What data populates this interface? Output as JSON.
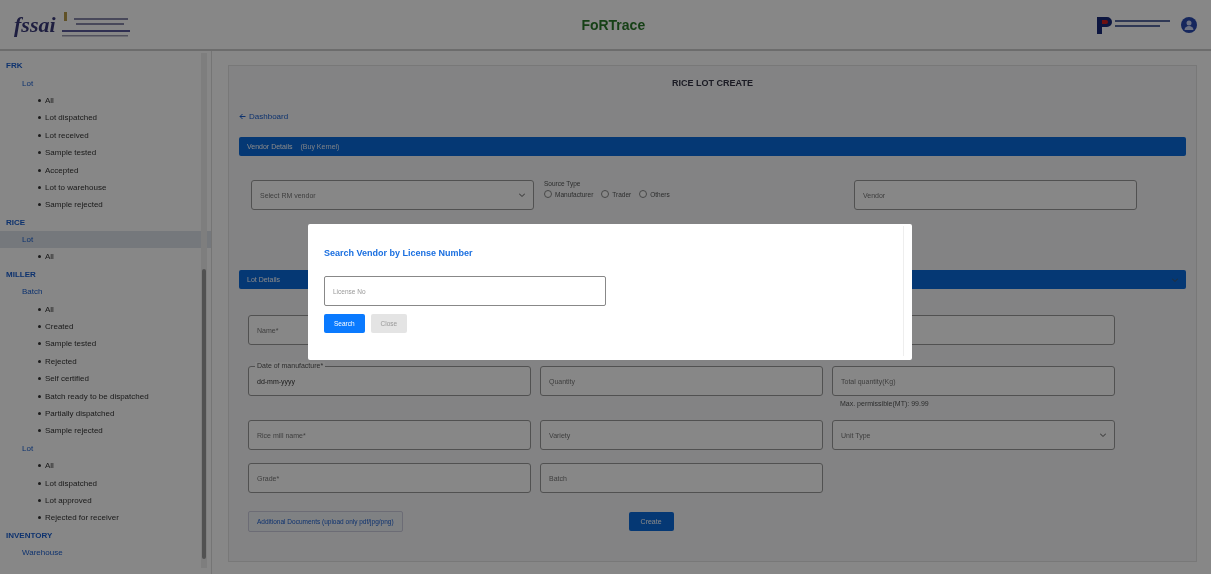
{
  "header": {
    "logo_text": "fssai",
    "title": "FoRTrace"
  },
  "sidebar": {
    "items": [
      {
        "label": "FRK",
        "selected": false,
        "children": [
          {
            "label": "Lot",
            "selected": false,
            "children": [
              {
                "label": "All",
                "selected": false
              },
              {
                "label": "Lot dispatched",
                "selected": false
              },
              {
                "label": "Lot received",
                "selected": false
              },
              {
                "label": "Sample tested",
                "selected": false
              },
              {
                "label": "Accepted",
                "selected": false
              },
              {
                "label": "Lot to warehouse",
                "selected": false
              },
              {
                "label": "Sample rejected",
                "selected": false
              }
            ]
          }
        ]
      },
      {
        "label": "RICE",
        "selected": false,
        "children": [
          {
            "label": "Lot",
            "selected": true,
            "children": [
              {
                "label": "All",
                "selected": false
              }
            ]
          }
        ]
      },
      {
        "label": "MILLER",
        "selected": false,
        "children": [
          {
            "label": "Batch",
            "selected": false,
            "children": [
              {
                "label": "All",
                "selected": false
              },
              {
                "label": "Created",
                "selected": false
              },
              {
                "label": "Sample tested",
                "selected": false
              },
              {
                "label": "Rejected",
                "selected": false
              },
              {
                "label": "Self certified",
                "selected": false
              },
              {
                "label": "Batch ready to be dispatched",
                "selected": false
              },
              {
                "label": "Partially dispatched",
                "selected": false
              },
              {
                "label": "Sample rejected",
                "selected": false
              }
            ]
          },
          {
            "label": "Lot",
            "selected": false,
            "children": [
              {
                "label": "All",
                "selected": false
              },
              {
                "label": "Lot dispatched",
                "selected": false
              },
              {
                "label": "Lot approved",
                "selected": false
              },
              {
                "label": "Rejected for receiver",
                "selected": false
              }
            ]
          }
        ]
      },
      {
        "label": "INVENTORY",
        "selected": false,
        "children": [
          {
            "label": "Warehouse",
            "selected": false
          }
        ]
      }
    ]
  },
  "page": {
    "title": "RICE LOT CREATE",
    "back_link": "Dashboard",
    "vendor_section": {
      "title": "Vendor Details",
      "subtitle": "(Buy Kernel)",
      "vendor_select": {
        "placeholder": "Select RM vendor"
      },
      "source_type": {
        "label": "Source Type",
        "options": [
          {
            "label": "Manufacturer",
            "selected": false
          },
          {
            "label": "Trader",
            "selected": false
          },
          {
            "label": "Others",
            "selected": false
          }
        ]
      },
      "vendor_field": {
        "placeholder": "Vendor"
      }
    },
    "lot_section": {
      "title": "Lot Details",
      "rows": [
        [
          {
            "kind": "text",
            "label": "Name*"
          },
          {
            "kind": "hidden"
          }
        ],
        [
          {
            "kind": "filled",
            "label": "Date of manufacture*",
            "value": "dd-mm-yyyy"
          },
          {
            "kind": "text",
            "label": "Quantity"
          },
          {
            "kind": "text",
            "label": "Total quantity(Kg)",
            "helper": "Max. permissible(MT): 99.99"
          }
        ],
        [
          {
            "kind": "text",
            "label": "Rice mill name*"
          },
          {
            "kind": "text",
            "label": "Variety"
          },
          {
            "kind": "select",
            "label": "Unit Type"
          }
        ],
        [
          {
            "kind": "text",
            "label": "Grade*"
          },
          {
            "kind": "text",
            "label": "Batch"
          }
        ]
      ]
    },
    "upload_button": "Additional Documents (upload only pdf/jpg/png)",
    "create_button": "Create"
  },
  "dialog": {
    "title": "Search Vendor by License Number",
    "input": {
      "placeholder": "License No"
    },
    "buttons": [
      {
        "label": "Search",
        "kind": "primary"
      },
      {
        "label": "Close",
        "kind": "secondary"
      }
    ]
  }
}
